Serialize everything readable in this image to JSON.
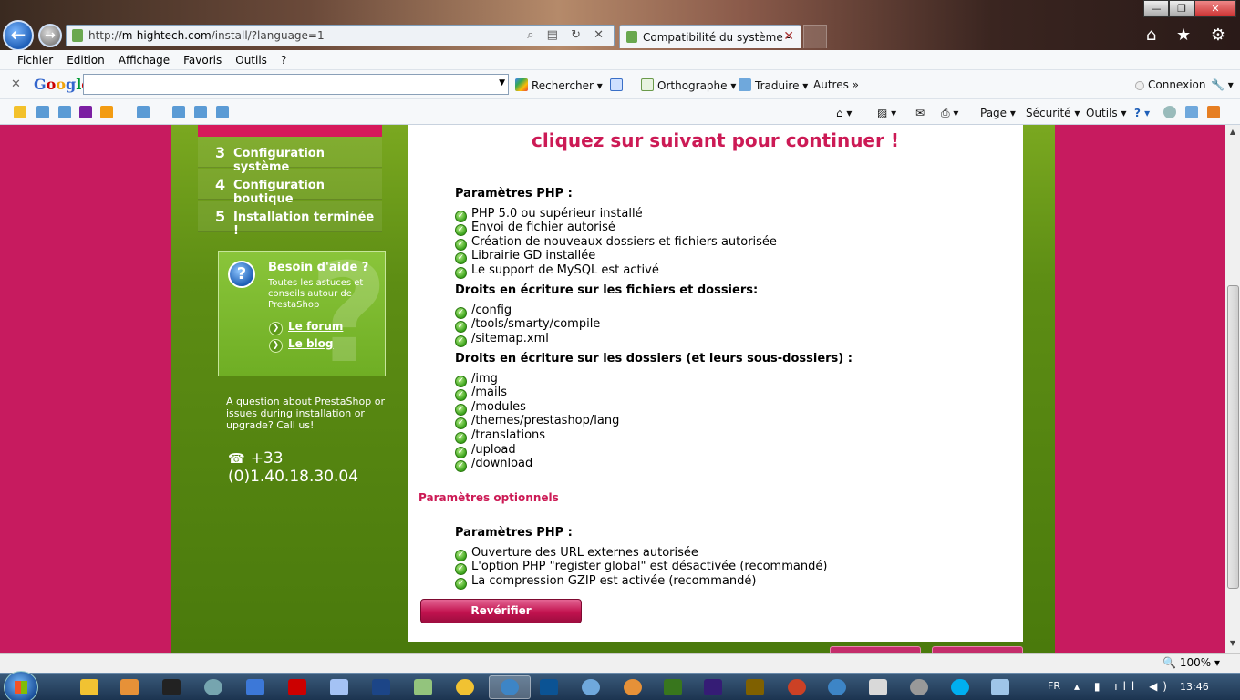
{
  "browser": {
    "url_prefix": "http://",
    "url_domain": "m-hightech.com",
    "url_path": "/install/?language=1",
    "tab_title": "Compatibilité du système - ...",
    "tab_close": "✕",
    "back_glyph": "←",
    "forward_glyph": "→",
    "address_icons": "⌕ ▤ ↻ ✕",
    "right_icons": "⌂ ★ ⚙",
    "win_minimize": "—",
    "win_maximize": "❐",
    "win_close": "✕"
  },
  "menubar": [
    "Fichier",
    "Edition",
    "Affichage",
    "Favoris",
    "Outils",
    "?"
  ],
  "googlebar": {
    "close": "✕",
    "logo": [
      "G",
      "o",
      "o",
      "g",
      "l",
      "e"
    ],
    "search_value": "",
    "search_dropdown": "▼",
    "rechercher": "Rechercher ▾",
    "orthographe": "Orthographe ▾",
    "traduire": "Traduire ▾",
    "autres": "Autres »",
    "connexion": "Connexion",
    "settings": "🔧 ▾"
  },
  "commandbar": {
    "page": "Page ▾",
    "securite": "Sécurité ▾",
    "outils": "Outils ▾",
    "help": "? ▾",
    "home": "⌂ ▾",
    "feeds": "▨ ▾",
    "mail": "✉",
    "print": "⎙ ▾"
  },
  "sidebar": {
    "steps": [
      {
        "num": "3",
        "label": "Configuration système"
      },
      {
        "num": "4",
        "label": "Configuration boutique"
      },
      {
        "num": "5",
        "label": "Installation terminée !"
      }
    ],
    "help": {
      "icon": "?",
      "title": "Besoin d'aide ?",
      "text": "Toutes les astuces et conseils autour de PrestaShop",
      "link_forum": "Le forum",
      "link_blog": "Le blog",
      "link_arrow": "❯"
    },
    "callus": "A question about PrestaShop or issues during installation or upgrade? Call us!",
    "phone_icon": "☎",
    "phone": "+33 (0)1.40.18.30.04"
  },
  "content": {
    "heading": "cliquez sur suivant pour continuer !",
    "check_glyph": "✓",
    "php_title": "Paramètres PHP :",
    "php_items": [
      "PHP 5.0 ou supérieur installé",
      "Envoi de fichier autorisé",
      "Création de nouveaux dossiers et fichiers autorisée",
      "Librairie GD installée",
      "Le support de MySQL est activé"
    ],
    "files_title": "Droits en écriture sur les fichiers et dossiers:",
    "files_items": [
      "/config",
      "/tools/smarty/compile",
      "/sitemap.xml"
    ],
    "dirs_title": "Droits en écriture sur les dossiers (et leurs sous-dossiers) :",
    "dirs_items": [
      "/img",
      "/mails",
      "/modules",
      "/themes/prestashop/lang",
      "/translations",
      "/upload",
      "/download"
    ],
    "optional_title": "Paramètres optionnels",
    "opt_php_title": "Paramètres PHP :",
    "opt_items": [
      "Ouverture des URL externes autorisée",
      "L'option PHP \"register global\" est désactivée (recommandé)",
      "La compression GZIP est activée (recommandé)"
    ],
    "recheck_button": "Revérifier"
  },
  "statusbar": {
    "zoom": "🔍 100%  ▾"
  },
  "taskbar": {
    "lang": "FR",
    "tray_icons": "▴ ▮ ıll ◀)",
    "time": "13:46"
  }
}
